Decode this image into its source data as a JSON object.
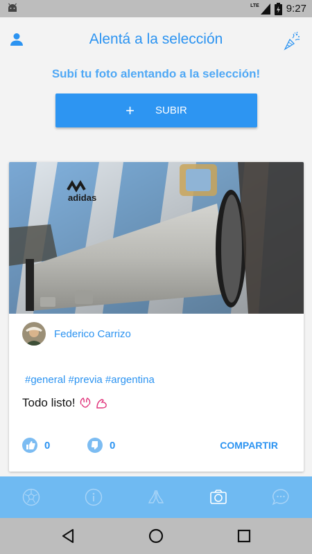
{
  "status_bar": {
    "network": "LTE",
    "time": "9:27",
    "icons": [
      "android-debug-icon",
      "lte-signal-icon",
      "battery-icon"
    ]
  },
  "header": {
    "title": "Alentá a la selección",
    "left_icon": "user-icon",
    "right_icon": "party-horn-icon"
  },
  "prompt": "Subí tu foto alentando a la selección!",
  "upload_button": {
    "icon": "plus-icon",
    "label": "SUBIR"
  },
  "post": {
    "author": "Federico Carrizo",
    "hashtags": "#general #previa #argentina",
    "caption": "Todo listo!",
    "caption_emojis": [
      "hands-icon",
      "flexed-arm-icon"
    ],
    "likes": "0",
    "dislikes": "0",
    "share_label": "COMPARTIR"
  },
  "bottom_tabs": [
    {
      "icon": "soccer-ball-icon",
      "active": false
    },
    {
      "icon": "info-icon",
      "active": false
    },
    {
      "icon": "praying-hands-icon",
      "active": false
    },
    {
      "icon": "camera-icon",
      "active": true
    },
    {
      "icon": "chat-bubble-icon",
      "active": false
    }
  ],
  "system_nav": [
    "back-icon",
    "home-icon",
    "recents-icon"
  ],
  "colors": {
    "accent": "#2b93f1",
    "tab_bar": "#6fbaf2",
    "system_bars": "#bdbdbd",
    "background": "#f3f3f3"
  }
}
